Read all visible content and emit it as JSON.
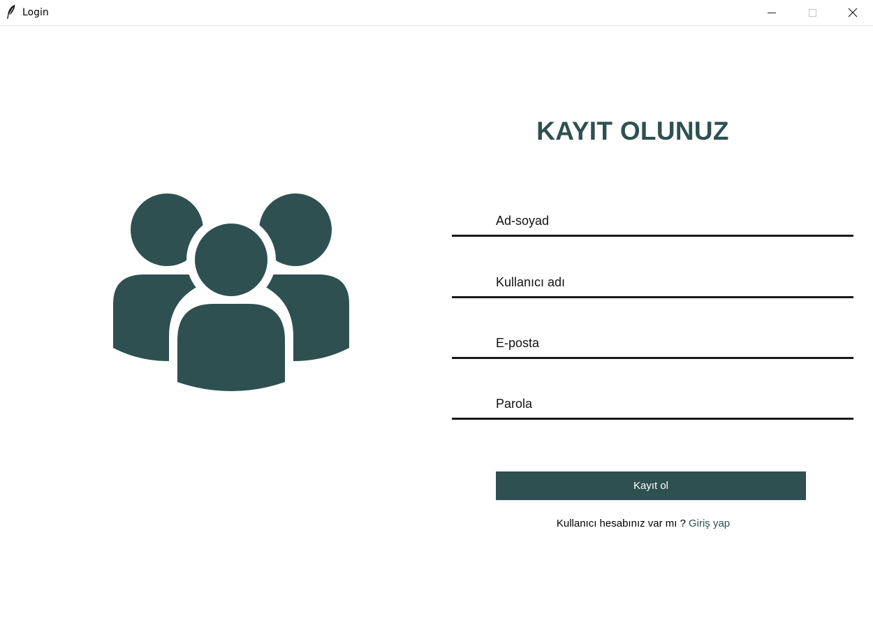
{
  "window": {
    "title": "Login",
    "icon": "feather-icon",
    "controls": [
      "minimize-icon",
      "maximize-icon",
      "close-icon"
    ]
  },
  "illustration": {
    "icon": "users-group-icon",
    "color": "#2f5050"
  },
  "form": {
    "title": "KAYIT OLUNUZ",
    "fields": [
      {
        "placeholder": "Ad-soyad",
        "value": ""
      },
      {
        "placeholder": "Kullanıcı adı",
        "value": ""
      },
      {
        "placeholder": "E-posta",
        "value": ""
      },
      {
        "placeholder": "Parola",
        "value": ""
      }
    ],
    "submit_label": "Kayıt ol",
    "prompt_text": "Kullanıcı hesabınız var mı ?",
    "login_link": "Giriş yap"
  },
  "colors": {
    "accent": "#2f5050",
    "background": "#ffffff",
    "underline": "#1a1a1a"
  }
}
